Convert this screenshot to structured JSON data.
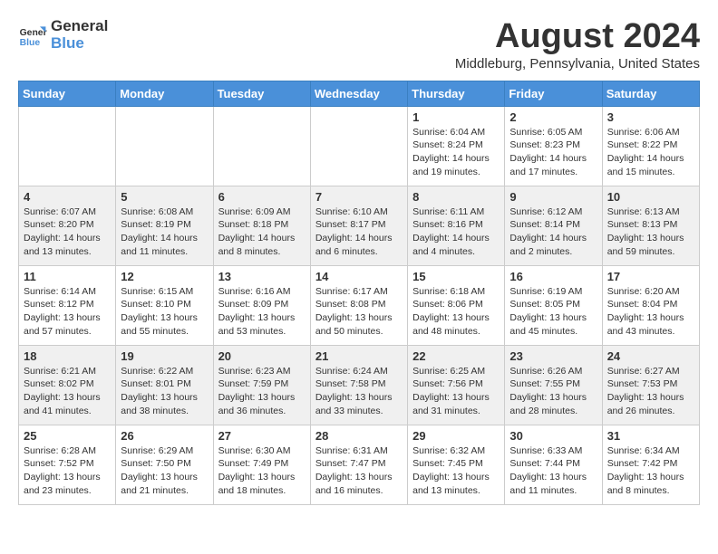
{
  "logo": {
    "line1": "General",
    "line2": "Blue"
  },
  "title": "August 2024",
  "location": "Middleburg, Pennsylvania, United States",
  "days_of_week": [
    "Sunday",
    "Monday",
    "Tuesday",
    "Wednesday",
    "Thursday",
    "Friday",
    "Saturday"
  ],
  "weeks": [
    [
      {
        "day": "",
        "info": ""
      },
      {
        "day": "",
        "info": ""
      },
      {
        "day": "",
        "info": ""
      },
      {
        "day": "",
        "info": ""
      },
      {
        "day": "1",
        "info": "Sunrise: 6:04 AM\nSunset: 8:24 PM\nDaylight: 14 hours\nand 19 minutes."
      },
      {
        "day": "2",
        "info": "Sunrise: 6:05 AM\nSunset: 8:23 PM\nDaylight: 14 hours\nand 17 minutes."
      },
      {
        "day": "3",
        "info": "Sunrise: 6:06 AM\nSunset: 8:22 PM\nDaylight: 14 hours\nand 15 minutes."
      }
    ],
    [
      {
        "day": "4",
        "info": "Sunrise: 6:07 AM\nSunset: 8:20 PM\nDaylight: 14 hours\nand 13 minutes."
      },
      {
        "day": "5",
        "info": "Sunrise: 6:08 AM\nSunset: 8:19 PM\nDaylight: 14 hours\nand 11 minutes."
      },
      {
        "day": "6",
        "info": "Sunrise: 6:09 AM\nSunset: 8:18 PM\nDaylight: 14 hours\nand 8 minutes."
      },
      {
        "day": "7",
        "info": "Sunrise: 6:10 AM\nSunset: 8:17 PM\nDaylight: 14 hours\nand 6 minutes."
      },
      {
        "day": "8",
        "info": "Sunrise: 6:11 AM\nSunset: 8:16 PM\nDaylight: 14 hours\nand 4 minutes."
      },
      {
        "day": "9",
        "info": "Sunrise: 6:12 AM\nSunset: 8:14 PM\nDaylight: 14 hours\nand 2 minutes."
      },
      {
        "day": "10",
        "info": "Sunrise: 6:13 AM\nSunset: 8:13 PM\nDaylight: 13 hours\nand 59 minutes."
      }
    ],
    [
      {
        "day": "11",
        "info": "Sunrise: 6:14 AM\nSunset: 8:12 PM\nDaylight: 13 hours\nand 57 minutes."
      },
      {
        "day": "12",
        "info": "Sunrise: 6:15 AM\nSunset: 8:10 PM\nDaylight: 13 hours\nand 55 minutes."
      },
      {
        "day": "13",
        "info": "Sunrise: 6:16 AM\nSunset: 8:09 PM\nDaylight: 13 hours\nand 53 minutes."
      },
      {
        "day": "14",
        "info": "Sunrise: 6:17 AM\nSunset: 8:08 PM\nDaylight: 13 hours\nand 50 minutes."
      },
      {
        "day": "15",
        "info": "Sunrise: 6:18 AM\nSunset: 8:06 PM\nDaylight: 13 hours\nand 48 minutes."
      },
      {
        "day": "16",
        "info": "Sunrise: 6:19 AM\nSunset: 8:05 PM\nDaylight: 13 hours\nand 45 minutes."
      },
      {
        "day": "17",
        "info": "Sunrise: 6:20 AM\nSunset: 8:04 PM\nDaylight: 13 hours\nand 43 minutes."
      }
    ],
    [
      {
        "day": "18",
        "info": "Sunrise: 6:21 AM\nSunset: 8:02 PM\nDaylight: 13 hours\nand 41 minutes."
      },
      {
        "day": "19",
        "info": "Sunrise: 6:22 AM\nSunset: 8:01 PM\nDaylight: 13 hours\nand 38 minutes."
      },
      {
        "day": "20",
        "info": "Sunrise: 6:23 AM\nSunset: 7:59 PM\nDaylight: 13 hours\nand 36 minutes."
      },
      {
        "day": "21",
        "info": "Sunrise: 6:24 AM\nSunset: 7:58 PM\nDaylight: 13 hours\nand 33 minutes."
      },
      {
        "day": "22",
        "info": "Sunrise: 6:25 AM\nSunset: 7:56 PM\nDaylight: 13 hours\nand 31 minutes."
      },
      {
        "day": "23",
        "info": "Sunrise: 6:26 AM\nSunset: 7:55 PM\nDaylight: 13 hours\nand 28 minutes."
      },
      {
        "day": "24",
        "info": "Sunrise: 6:27 AM\nSunset: 7:53 PM\nDaylight: 13 hours\nand 26 minutes."
      }
    ],
    [
      {
        "day": "25",
        "info": "Sunrise: 6:28 AM\nSunset: 7:52 PM\nDaylight: 13 hours\nand 23 minutes."
      },
      {
        "day": "26",
        "info": "Sunrise: 6:29 AM\nSunset: 7:50 PM\nDaylight: 13 hours\nand 21 minutes."
      },
      {
        "day": "27",
        "info": "Sunrise: 6:30 AM\nSunset: 7:49 PM\nDaylight: 13 hours\nand 18 minutes."
      },
      {
        "day": "28",
        "info": "Sunrise: 6:31 AM\nSunset: 7:47 PM\nDaylight: 13 hours\nand 16 minutes."
      },
      {
        "day": "29",
        "info": "Sunrise: 6:32 AM\nSunset: 7:45 PM\nDaylight: 13 hours\nand 13 minutes."
      },
      {
        "day": "30",
        "info": "Sunrise: 6:33 AM\nSunset: 7:44 PM\nDaylight: 13 hours\nand 11 minutes."
      },
      {
        "day": "31",
        "info": "Sunrise: 6:34 AM\nSunset: 7:42 PM\nDaylight: 13 hours\nand 8 minutes."
      }
    ]
  ]
}
